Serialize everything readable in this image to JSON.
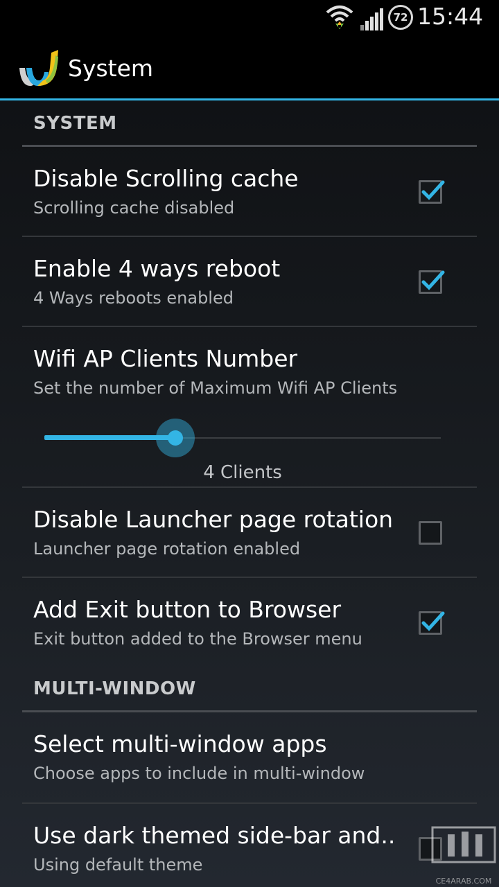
{
  "status_bar": {
    "clock": "15:44",
    "battery_level": "72",
    "icons": [
      "wifi-icon",
      "signal-icon",
      "battery-icon"
    ]
  },
  "action_bar": {
    "title": "System",
    "icon": "app-logo-icon"
  },
  "sections": {
    "system": {
      "label": "SYSTEM",
      "prefs": [
        {
          "title": "Disable Scrolling cache",
          "summary": "Scrolling cache disabled",
          "checked": true
        },
        {
          "title": "Enable 4 ways reboot",
          "summary": "4 Ways reboots enabled",
          "checked": true
        }
      ],
      "slider": {
        "title": "Wifi AP Clients Number",
        "summary": "Set the number of Maximum Wifi AP Clients",
        "value_label": "4 Clients",
        "fill_fraction": 0.33
      },
      "prefs2": [
        {
          "title": "Disable Launcher page rotation",
          "summary": "Launcher page rotation enabled",
          "checked": false
        },
        {
          "title": "Add Exit button to Browser",
          "summary": "Exit button added to the Browser menu",
          "checked": true
        }
      ]
    },
    "multi_window": {
      "label": "MULTI-WINDOW",
      "prefs": [
        {
          "title": "Select multi-window apps",
          "summary": "Choose apps to include in multi-window"
        },
        {
          "title": "Use dark themed side-bar and..",
          "summary": "Using default theme",
          "checked": false
        }
      ]
    }
  },
  "watermark": {
    "text": "CE4ARAB.COM"
  },
  "colors": {
    "accent": "#33b5e5",
    "background": "#1b1e22",
    "bar": "#000000"
  }
}
